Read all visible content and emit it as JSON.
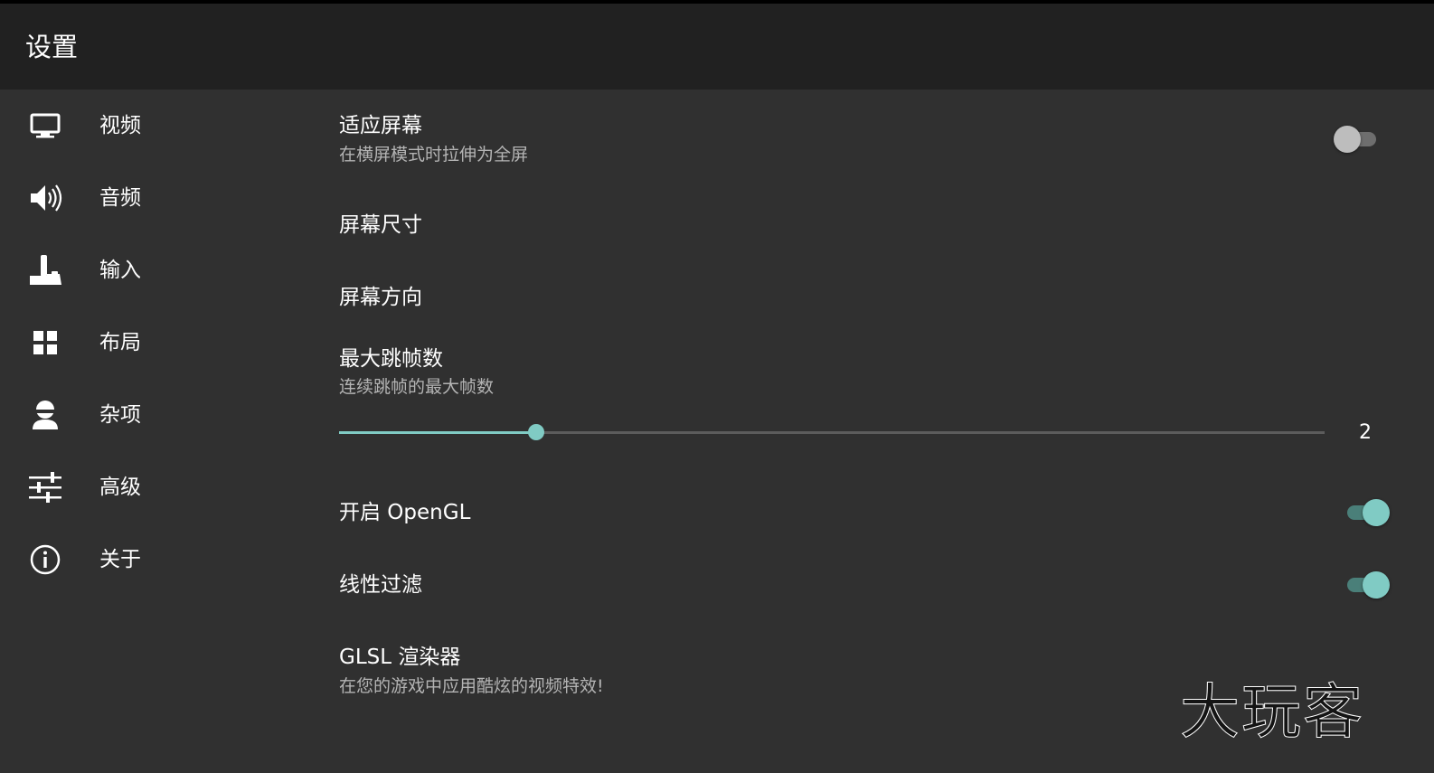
{
  "header": {
    "title": "设置"
  },
  "sidebar": {
    "items": [
      {
        "label": "视频",
        "icon": "monitor-icon"
      },
      {
        "label": "音频",
        "icon": "speaker-icon"
      },
      {
        "label": "输入",
        "icon": "joystick-icon"
      },
      {
        "label": "布局",
        "icon": "grid-icon"
      },
      {
        "label": "杂项",
        "icon": "user-icon"
      },
      {
        "label": "高级",
        "icon": "sliders-icon"
      },
      {
        "label": "关于",
        "icon": "info-icon"
      }
    ]
  },
  "prefs": {
    "fit_screen": {
      "title": "适应屏幕",
      "summary": "在横屏模式时拉伸为全屏",
      "enabled": false
    },
    "screen_size": {
      "title": "屏幕尺寸"
    },
    "screen_orientation": {
      "title": "屏幕方向"
    },
    "max_frameskip": {
      "title": "最大跳帧数",
      "summary": "连续跳帧的最大帧数",
      "value": "2",
      "slider_fraction": 0.2
    },
    "opengl": {
      "title": "开启 OpenGL",
      "enabled": true
    },
    "linear_filter": {
      "title": "线性过滤",
      "enabled": true
    },
    "glsl": {
      "title": "GLSL 渲染器",
      "summary": "在您的游戏中应用酷炫的视频特效!"
    }
  },
  "watermark": {
    "text": "大玩客"
  },
  "colors": {
    "accent": "#80cbc4",
    "background": "#303030",
    "header": "#212121",
    "summary_text": "#b4b4b4"
  }
}
